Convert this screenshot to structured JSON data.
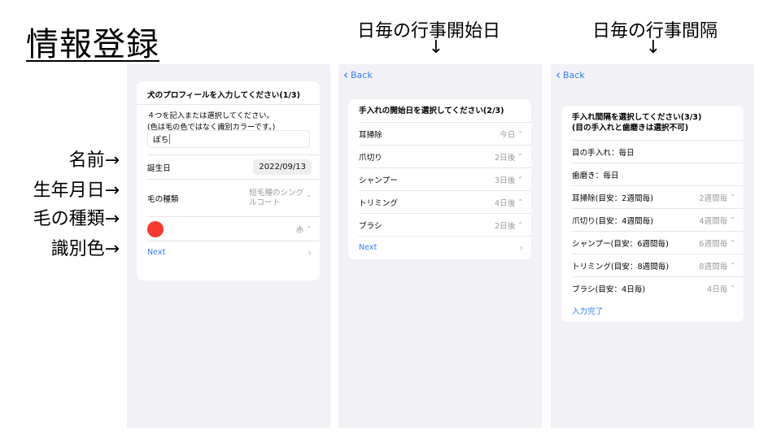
{
  "slide": {
    "title": "情報登録",
    "side_labels": [
      "名前→",
      "生年月日→",
      "毛の種類→",
      "識別色→"
    ],
    "captions": [
      {
        "text": "日毎の行事開始日",
        "arrow": "↓"
      },
      {
        "text": "日毎の行事間隔",
        "arrow": "↓"
      }
    ]
  },
  "screen1": {
    "title": "犬のプロフィールを入力してください(1/3)",
    "desc_line1": "４つを記入または選択してください。",
    "desc_line2": "(色は毛の色ではなく識別カラーです。)",
    "name_value": "ぽち",
    "birth_label": "誕生日",
    "birth_value": "2022/09/13",
    "fur_label": "毛の種類",
    "fur_value_line1": "短毛種のシング",
    "fur_value_line2": "ルコート",
    "color_value": "赤",
    "color_hex": "#f53b30",
    "next_label": "Next"
  },
  "screen2": {
    "back_label": "Back",
    "title": "手入れの開始日を選択してください(2/3)",
    "rows": [
      {
        "label": "耳掃除",
        "value": "今日"
      },
      {
        "label": "爪切り",
        "value": "2日後"
      },
      {
        "label": "シャンプー",
        "value": "3日後"
      },
      {
        "label": "トリミング",
        "value": "4日後"
      },
      {
        "label": "ブラシ",
        "value": "2日後"
      }
    ],
    "next_label": "Next"
  },
  "screen3": {
    "back_label": "Back",
    "title_line1": "手入れ間隔を選択してください(3/3)",
    "title_line2": "(目の手入れと歯磨きは選択不可)",
    "fixed_rows": [
      "目の手入れ：毎日",
      "歯磨き：毎日"
    ],
    "rows": [
      {
        "label": "耳掃除(目安：2週間毎)",
        "value": "2週間毎"
      },
      {
        "label": "爪切り(目安：4週間毎)",
        "value": "4週間毎"
      },
      {
        "label": "シャンプー(目安：6週間毎)",
        "value": "6週間毎"
      },
      {
        "label": "トリミング(目安：8週間毎)",
        "value": "8週間毎"
      },
      {
        "label": "ブラシ(目安：4日毎)",
        "value": "4日毎"
      }
    ],
    "done_label": "入力完了"
  },
  "colors": {
    "accent": "#2f7cf6",
    "screen_bg": "#f1f1f6",
    "color_dot": "#f53b30"
  }
}
